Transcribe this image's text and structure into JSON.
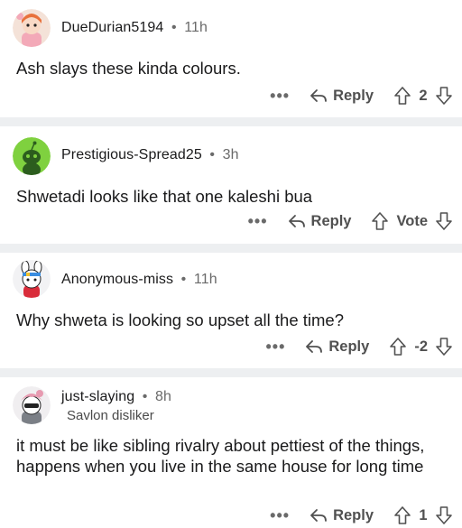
{
  "comments": [
    {
      "username": "DueDurian5194",
      "time": "11h",
      "flair": "",
      "body": "Ash slays these kinda colours.",
      "more": "•••",
      "reply_label": "Reply",
      "vote_count": "2"
    },
    {
      "username": "Prestigious-Spread25",
      "time": "3h",
      "flair": "",
      "body": "Shwetadi looks like that one kaleshi bua",
      "more": "•••",
      "reply_label": "Reply",
      "vote_count": "Vote"
    },
    {
      "username": "Anonymous-miss",
      "time": "11h",
      "flair": "",
      "body": "Why shweta is looking so upset all the time?",
      "more": "•••",
      "reply_label": "Reply",
      "vote_count": "-2"
    },
    {
      "username": "just-slaying",
      "time": "8h",
      "flair": "Savlon disliker",
      "body": "it must be like sibling rivalry about pettiest of the things, happens when you live in the same house for long time",
      "more": "•••",
      "reply_label": "Reply",
      "vote_count": "1"
    }
  ],
  "separator": "•",
  "icons": {
    "reply": "reply-arrow-icon",
    "upvote": "upvote-arrow-icon",
    "downvote": "downvote-arrow-icon"
  },
  "colors": {
    "separator_bg": "#edeff1",
    "text": "#1a1a1b",
    "muted": "#505050"
  }
}
